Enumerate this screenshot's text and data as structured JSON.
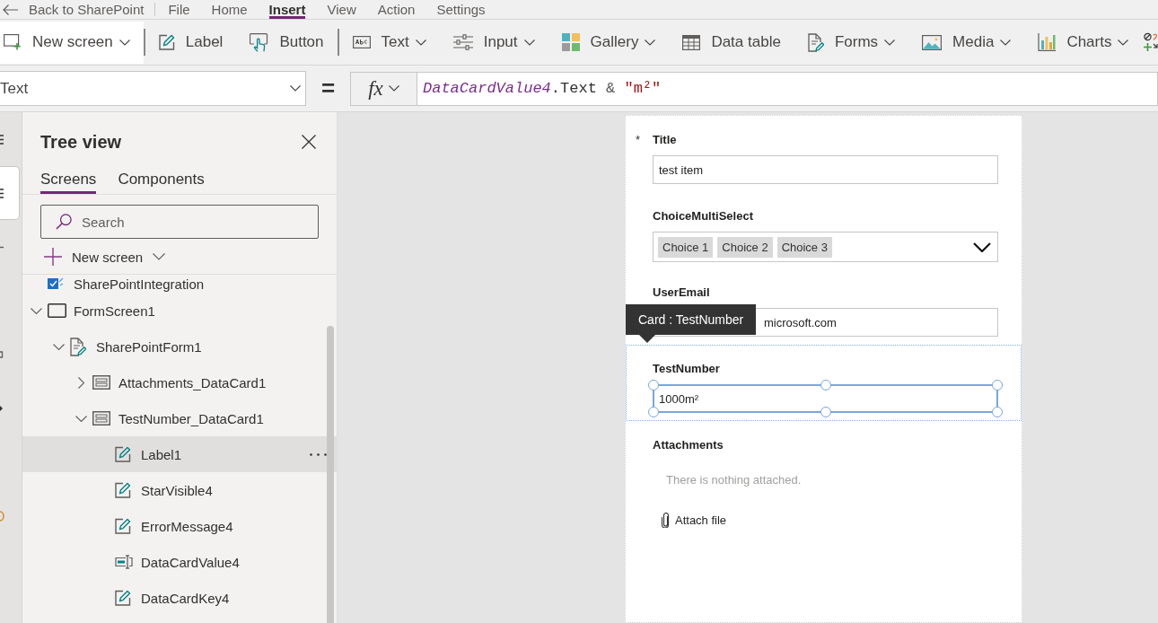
{
  "menu_bar": {
    "back": "Back to SharePoint",
    "items": [
      {
        "label": "File",
        "selected": false
      },
      {
        "label": "Home",
        "selected": false
      },
      {
        "label": "Insert",
        "selected": true
      },
      {
        "label": "View",
        "selected": false
      },
      {
        "label": "Action",
        "selected": false
      },
      {
        "label": "Settings",
        "selected": false
      }
    ]
  },
  "toolbar": {
    "groups": [
      [
        {
          "kind": "new-screen",
          "label": "New screen",
          "dropdown": true,
          "highlighted": true
        }
      ],
      [
        {
          "kind": "label",
          "label": "Label",
          "dropdown": false,
          "highlighted": false
        },
        {
          "kind": "button",
          "label": "Button",
          "dropdown": false,
          "highlighted": false
        }
      ],
      [
        {
          "kind": "text",
          "label": "Text",
          "dropdown": true,
          "highlighted": false
        },
        {
          "kind": "input",
          "label": "Input",
          "dropdown": true,
          "highlighted": false
        },
        {
          "kind": "gallery",
          "label": "Gallery",
          "dropdown": true,
          "highlighted": false
        },
        {
          "kind": "data-table",
          "label": "Data table",
          "dropdown": false,
          "highlighted": false
        },
        {
          "kind": "forms",
          "label": "Forms",
          "dropdown": true,
          "highlighted": false
        },
        {
          "kind": "media",
          "label": "Media",
          "dropdown": true,
          "highlighted": false
        },
        {
          "kind": "charts",
          "label": "Charts",
          "dropdown": true,
          "highlighted": false
        },
        {
          "kind": "icons",
          "dropdown": false,
          "highlighted": false
        }
      ]
    ]
  },
  "formula_bar": {
    "property": "Text",
    "equals": "=",
    "fx": "fx",
    "formula": [
      {
        "kind": "identifier",
        "text": "DataCardValue4"
      },
      {
        "kind": "member",
        "text": ".Text"
      },
      {
        "kind": "operator",
        "text": " & "
      },
      {
        "kind": "string",
        "text": "\"m²\""
      }
    ]
  },
  "rail": {
    "groups": [
      [
        {
          "kind": "lines",
          "selected": false
        },
        {
          "kind": "lines",
          "selected": true
        },
        {
          "kind": "dash",
          "selected": false
        }
      ],
      [
        {
          "kind": "bracket",
          "selected": false
        },
        {
          "kind": "triangle",
          "selected": false
        }
      ],
      [
        {
          "kind": "arc",
          "selected": false
        }
      ]
    ]
  },
  "tree_view": {
    "title": "Tree view",
    "tabs": [
      {
        "label": "Screens",
        "selected": true
      },
      {
        "label": "Components",
        "selected": false
      }
    ],
    "search": {
      "placeholder": "Search"
    },
    "new_screen": "New screen",
    "items": [
      {
        "kind": "app",
        "label": "SharePointIntegration",
        "selected": false
      },
      {
        "kind": "screen",
        "label": "FormScreen1",
        "expanded": true,
        "selected": false,
        "children": [
          {
            "kind": "form",
            "label": "SharePointForm1",
            "expanded": true,
            "selected": false,
            "children": [
              {
                "kind": "card",
                "label": "Attachments_DataCard1",
                "expanded": false,
                "selected": false
              },
              {
                "kind": "card",
                "label": "TestNumber_DataCard1",
                "expanded": true,
                "selected": false,
                "children": [
                  {
                    "kind": "label",
                    "label": "Label1",
                    "selected": true
                  },
                  {
                    "kind": "label",
                    "label": "StarVisible4",
                    "selected": false
                  },
                  {
                    "kind": "label",
                    "label": "ErrorMessage4",
                    "selected": false
                  },
                  {
                    "kind": "text-input",
                    "label": "DataCardValue4",
                    "selected": false
                  },
                  {
                    "kind": "label",
                    "label": "DataCardKey4",
                    "selected": false
                  }
                ]
              }
            ]
          }
        ]
      }
    ]
  },
  "canvas": {
    "tooltip": "Card : TestNumber",
    "fields": [
      {
        "kind": "text",
        "label": "Title",
        "required_marker": "*",
        "value": "test item",
        "selected": false
      },
      {
        "kind": "choices",
        "label": "ChoiceMultiSelect",
        "chips": [
          "Choice 1",
          "Choice 2",
          "Choice 3"
        ],
        "selected": false
      },
      {
        "kind": "text",
        "label": "UserEmail",
        "value": "microsoft.com",
        "selected": false
      },
      {
        "kind": "text",
        "label": "TestNumber",
        "value": "1000m²",
        "selected": true
      },
      {
        "kind": "attachments",
        "label": "Attachments",
        "empty_text": "There is nothing attached.",
        "action": "Attach file",
        "selected": false
      }
    ]
  }
}
